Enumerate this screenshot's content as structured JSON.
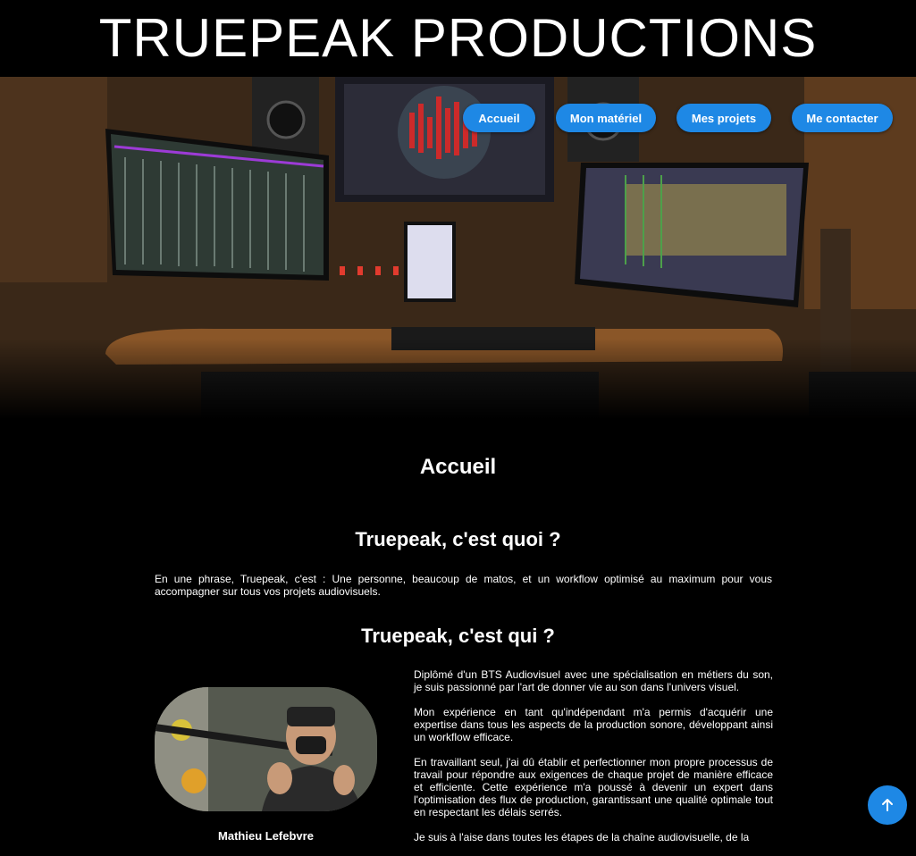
{
  "site": {
    "title": "TRUEPEAK PRODUCTIONS"
  },
  "nav": {
    "items": [
      {
        "label": "Accueil"
      },
      {
        "label": "Mon matériel"
      },
      {
        "label": "Mes projets"
      },
      {
        "label": "Me contacter"
      }
    ]
  },
  "hero": {
    "alt": "Studio setup"
  },
  "main": {
    "heading": "Accueil",
    "section1": {
      "heading": "Truepeak, c'est quoi ?",
      "text": "En une phrase, Truepeak, c'est : Une personne, beaucoup de matos, et un workflow optimisé au maximum pour vous accompagner sur tous vos projets audiovisuels."
    },
    "section2": {
      "heading": "Truepeak, c'est qui ?",
      "portrait_name": "Mathieu Lefebvre",
      "paragraphs": [
        "Diplômé d'un BTS Audiovisuel avec une spécialisation en métiers du son, je suis passionné par l'art de donner vie au son dans l'univers visuel.",
        "Mon expérience en tant qu'indépendant m'a permis d'acquérir une expertise dans tous les aspects de la production sonore, développant ainsi un workflow efficace.",
        "En travaillant seul, j'ai dû établir et perfectionner mon propre processus de travail pour répondre aux exigences de chaque projet de manière efficace et efficiente. Cette expérience m'a poussé à devenir un expert dans l'optimisation des flux de production, garantissant une qualité optimale tout en respectant les délais serrés.",
        "Je suis à l'aise dans toutes les étapes de la chaîne audiovisuelle, de la"
      ]
    }
  },
  "scroll_top": {
    "icon": "arrow-up-icon"
  },
  "colors": {
    "accent": "#1e88e5",
    "background": "#000000",
    "text": "#ffffff"
  }
}
